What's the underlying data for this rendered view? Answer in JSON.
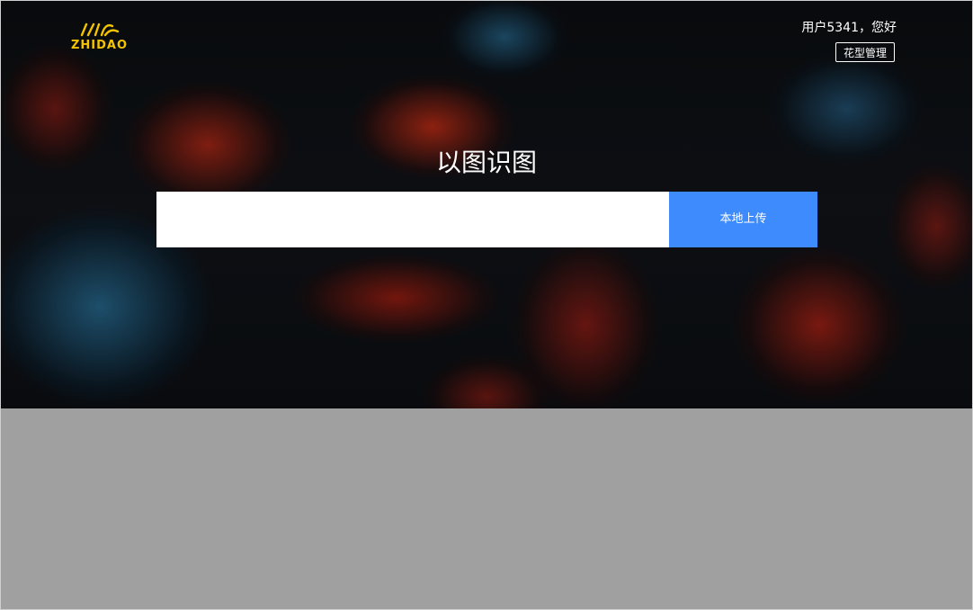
{
  "header": {
    "logo_text": "ZHIDAO",
    "greeting": "用户5341，您好",
    "manage_label": "花型管理"
  },
  "hero": {
    "title": "以图识图"
  },
  "search": {
    "value": "",
    "placeholder": "",
    "upload_label": "本地上传"
  },
  "colors": {
    "accent": "#3d8bfd",
    "logo": "#f3c400",
    "content_background": "#a0a0a0"
  }
}
